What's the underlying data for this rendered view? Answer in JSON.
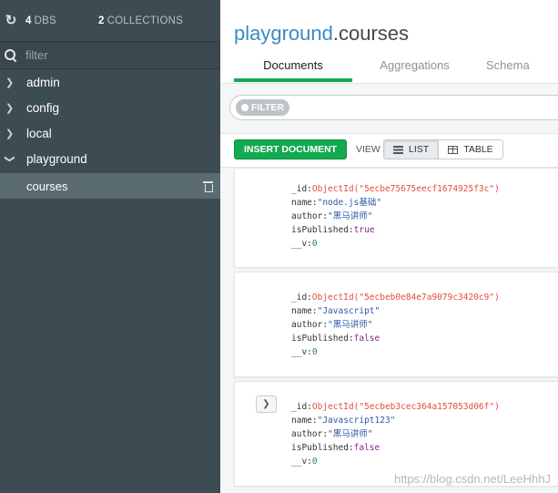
{
  "sidebar": {
    "refresh_icon": "refresh-icon",
    "db_count": "4",
    "db_label": "DBS",
    "coll_count": "2",
    "coll_label": "COLLECTIONS",
    "filter_placeholder": "filter",
    "databases": [
      {
        "name": "admin",
        "expanded": false
      },
      {
        "name": "config",
        "expanded": false
      },
      {
        "name": "local",
        "expanded": false
      },
      {
        "name": "playground",
        "expanded": true
      }
    ],
    "collections": [
      {
        "name": "courses",
        "selected": true
      }
    ]
  },
  "header": {
    "db": "playground",
    "dot": ".",
    "collection": "courses",
    "tabs": [
      "Documents",
      "Aggregations",
      "Schema"
    ]
  },
  "filterbar": {
    "pill": "FILTER"
  },
  "toolbar": {
    "insert": "INSERT DOCUMENT",
    "view": "VIEW",
    "list": "LIST",
    "table": "TABLE"
  },
  "documents": [
    {
      "id_key": "_id:",
      "id_val": "ObjectId(\"5ecbe75675eecf1674925f3c\")",
      "name_key": "name:",
      "name_val": "\"node.js基础\"",
      "author_key": "author:",
      "author_val": "\"黑马讲师\"",
      "pub_key": "isPublished:",
      "pub_val": "true",
      "v_key": "__v:",
      "v_val": "0"
    },
    {
      "id_key": "_id:",
      "id_val": "ObjectId(\"5ecbeb0e84e7a9079c3420c9\")",
      "name_key": "name:",
      "name_val": "\"Javascript\"",
      "author_key": "author:",
      "author_val": "\"黑马讲师\"",
      "pub_key": "isPublished:",
      "pub_val": "false",
      "v_key": "__v:",
      "v_val": "0"
    },
    {
      "id_key": "_id:",
      "id_val": "ObjectId(\"5ecbeb3cec364a157053d06f\")",
      "name_key": "name:",
      "name_val": "\"Javascript123\"",
      "author_key": "author:",
      "author_val": "\"黑马讲师\"",
      "pub_key": "isPublished:",
      "pub_val": "false",
      "v_key": "__v:",
      "v_val": "0"
    }
  ],
  "watermark": "https://blog.csdn.net/LeeHhhJ",
  "colors": {
    "accent_green": "#13aa52",
    "title_blue": "#3c8bc4",
    "sidebar_bg": "#3d4b52"
  }
}
